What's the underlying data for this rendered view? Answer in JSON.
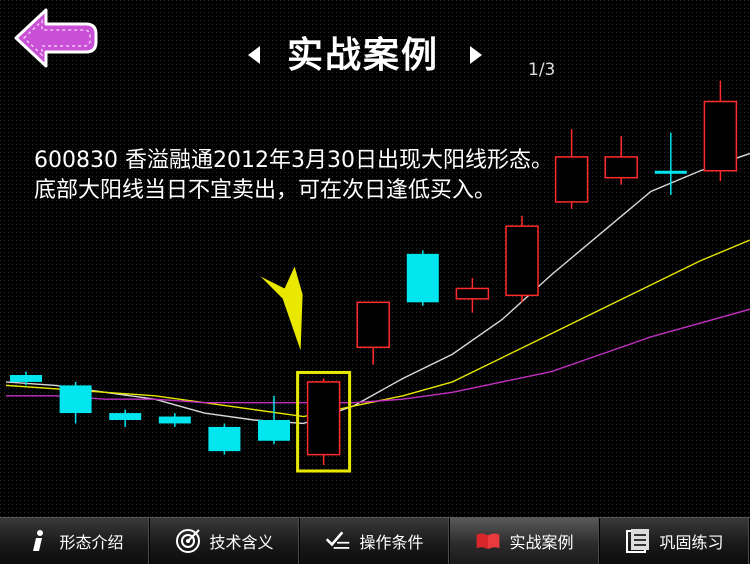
{
  "header": {
    "title": "实战案例",
    "page_indicator": "1/3",
    "back_icon": "back-arrow-icon",
    "prev_icon": "chevron-left-icon",
    "next_icon": "chevron-right-icon"
  },
  "content": {
    "description": "600830 香溢融通2012年3月30日出现大阳线形态。底部大阳线当日不宜卖出，可在次日逢低买入。"
  },
  "chart_data": {
    "type": "candlestick",
    "title": "",
    "up_color": "#ff2a2a",
    "down_color": "#00e5ee",
    "highlight_color": "#e8e800",
    "marker": "arrow",
    "price_range": [
      0,
      100
    ],
    "candles": [
      {
        "open": 39,
        "close": 37,
        "high": 40,
        "low": 36,
        "direction": "down"
      },
      {
        "open": 36,
        "close": 28,
        "high": 37,
        "low": 25,
        "direction": "down"
      },
      {
        "open": 28,
        "close": 26,
        "high": 29,
        "low": 24,
        "direction": "down"
      },
      {
        "open": 27,
        "close": 25,
        "high": 28,
        "low": 24,
        "direction": "down"
      },
      {
        "open": 24,
        "close": 17,
        "high": 25,
        "low": 16,
        "direction": "down"
      },
      {
        "open": 26,
        "close": 20,
        "high": 33,
        "low": 19,
        "direction": "down"
      },
      {
        "open": 16,
        "close": 37,
        "high": 38,
        "low": 13,
        "direction": "up",
        "highlighted": true
      },
      {
        "open": 47,
        "close": 60,
        "high": 60,
        "low": 42,
        "direction": "up"
      },
      {
        "open": 74,
        "close": 60,
        "high": 75,
        "low": 59,
        "direction": "down"
      },
      {
        "open": 61,
        "close": 64,
        "high": 67,
        "low": 57,
        "direction": "up"
      },
      {
        "open": 62,
        "close": 82,
        "high": 85,
        "low": 60,
        "direction": "up"
      },
      {
        "open": 89,
        "close": 102,
        "high": 110,
        "low": 87,
        "direction": "up"
      },
      {
        "open": 96,
        "close": 102,
        "high": 108,
        "low": 94,
        "direction": "up"
      },
      {
        "open": 98,
        "close": 98,
        "high": 109,
        "low": 91,
        "direction": "doji"
      },
      {
        "open": 98,
        "close": 118,
        "high": 124,
        "low": 95,
        "direction": "up"
      }
    ],
    "moving_averages": [
      {
        "color": "#d8d8d8",
        "values": [
          37,
          36,
          34,
          32,
          28,
          26,
          25,
          30,
          38,
          45,
          55,
          68,
          80,
          92,
          98,
          103
        ]
      },
      {
        "color": "#e6e600",
        "values": [
          36,
          35,
          34,
          33,
          31,
          29,
          27,
          30,
          33,
          37,
          44,
          51,
          58,
          65,
          72,
          78
        ]
      },
      {
        "color": "#c030c0",
        "values": [
          33,
          33,
          32,
          32,
          31,
          31,
          31,
          31,
          32,
          34,
          37,
          40,
          45,
          50,
          54,
          58
        ]
      }
    ]
  },
  "tabs": [
    {
      "label": "形态介绍",
      "icon": "info-icon",
      "active": false
    },
    {
      "label": "技术含义",
      "icon": "target-icon",
      "active": false
    },
    {
      "label": "操作条件",
      "icon": "checklist-icon",
      "active": false
    },
    {
      "label": "实战案例",
      "icon": "book-icon",
      "active": true
    },
    {
      "label": "巩固练习",
      "icon": "notebook-icon",
      "active": false
    }
  ]
}
